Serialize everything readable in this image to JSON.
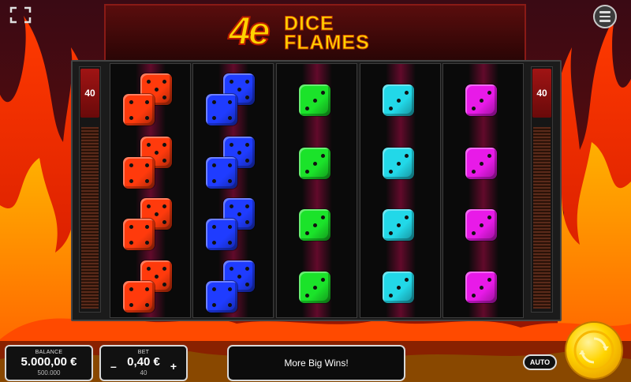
{
  "logo": {
    "number": "4e",
    "word1": "DICE",
    "word2": "FLAMES"
  },
  "lines_left": "40",
  "lines_right": "40",
  "reels": [
    {
      "color": "#ff3a0c",
      "type": "double",
      "symbols": 4
    },
    {
      "color": "#1f3cff",
      "type": "double",
      "symbols": 4
    },
    {
      "color": "#1be32a",
      "type": "single",
      "symbols": 4
    },
    {
      "color": "#22d8e8",
      "type": "single",
      "symbols": 4
    },
    {
      "color": "#e81ae8",
      "type": "single",
      "symbols": 4
    }
  ],
  "balance": {
    "label": "BALANCE",
    "value": "5.000,00 €",
    "sub": "500.000"
  },
  "bet": {
    "label": "BET",
    "value": "0,40 €",
    "sub": "40",
    "minus": "–",
    "plus": "+"
  },
  "message": "More Big Wins!",
  "auto_label": "AUTO",
  "icons": {
    "fullscreen": "fullscreen-icon",
    "menu": "hamburger-menu-icon",
    "spin": "spin-arrows-icon"
  }
}
